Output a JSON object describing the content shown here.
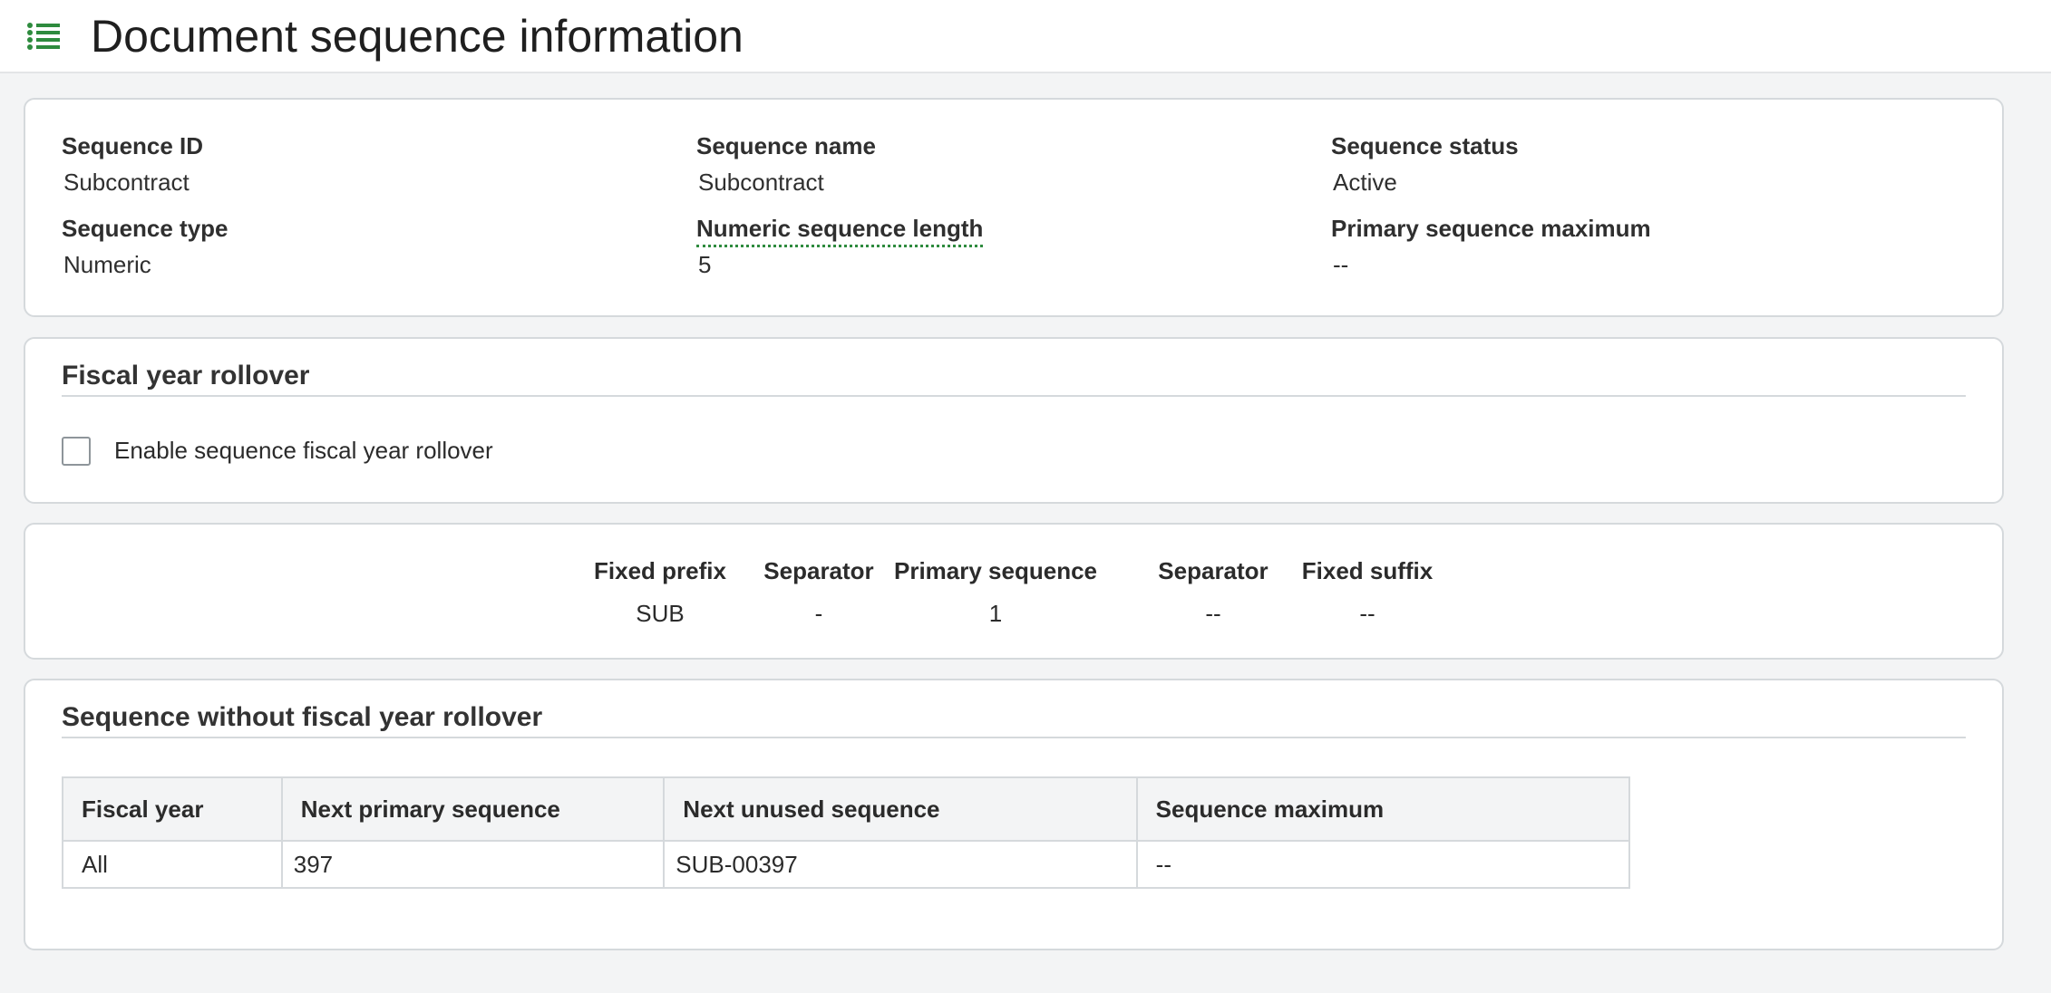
{
  "page": {
    "title": "Document sequence information"
  },
  "details": {
    "sequence_id": {
      "label": "Sequence ID",
      "value": "Subcontract"
    },
    "sequence_name": {
      "label": "Sequence name",
      "value": "Subcontract"
    },
    "sequence_status": {
      "label": "Sequence status",
      "value": "Active"
    },
    "sequence_type": {
      "label": "Sequence type",
      "value": "Numeric"
    },
    "numeric_length": {
      "label": "Numeric sequence length",
      "value": "5"
    },
    "primary_max": {
      "label": "Primary sequence maximum",
      "value": "--"
    }
  },
  "fiscal_rollover": {
    "title": "Fiscal year rollover",
    "checkbox_label": "Enable sequence fiscal year rollover",
    "checked": false
  },
  "format": [
    {
      "header": "Fixed prefix",
      "value": "SUB"
    },
    {
      "header": "Separator",
      "value": "-"
    },
    {
      "header": "Primary sequence",
      "value": "1"
    },
    {
      "header": "Separator",
      "value": "--"
    },
    {
      "header": "Fixed suffix",
      "value": "--"
    }
  ],
  "no_rollover": {
    "title": "Sequence without fiscal year rollover",
    "columns": [
      "Fiscal year",
      "Next primary sequence",
      "Next unused sequence",
      "Sequence maximum"
    ],
    "rows": [
      [
        "All",
        "397",
        "SUB-00397",
        "--"
      ]
    ]
  },
  "colors": {
    "accent": "#2e8b3e",
    "border": "#d5d9dc",
    "background": "#f3f4f5"
  },
  "icons": {
    "menu": "list-icon"
  }
}
